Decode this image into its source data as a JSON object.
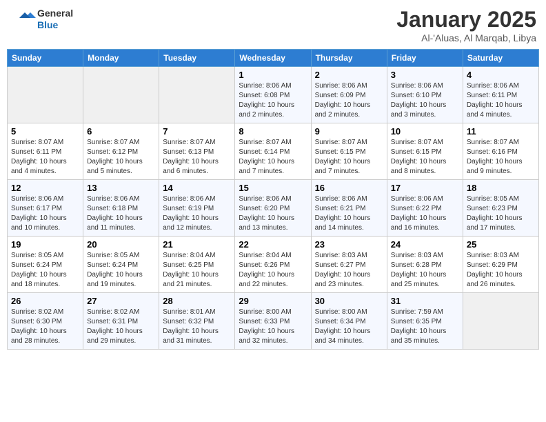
{
  "header": {
    "logo_general": "General",
    "logo_blue": "Blue",
    "month_title": "January 2025",
    "subtitle": "Al-'Aluas, Al Marqab, Libya"
  },
  "weekdays": [
    "Sunday",
    "Monday",
    "Tuesday",
    "Wednesday",
    "Thursday",
    "Friday",
    "Saturday"
  ],
  "weeks": [
    [
      {
        "day": "",
        "sunrise": "",
        "sunset": "",
        "daylight": "",
        "empty": true
      },
      {
        "day": "",
        "sunrise": "",
        "sunset": "",
        "daylight": "",
        "empty": true
      },
      {
        "day": "",
        "sunrise": "",
        "sunset": "",
        "daylight": "",
        "empty": true
      },
      {
        "day": "1",
        "sunrise": "Sunrise: 8:06 AM",
        "sunset": "Sunset: 6:08 PM",
        "daylight": "Daylight: 10 hours and 2 minutes."
      },
      {
        "day": "2",
        "sunrise": "Sunrise: 8:06 AM",
        "sunset": "Sunset: 6:09 PM",
        "daylight": "Daylight: 10 hours and 2 minutes."
      },
      {
        "day": "3",
        "sunrise": "Sunrise: 8:06 AM",
        "sunset": "Sunset: 6:10 PM",
        "daylight": "Daylight: 10 hours and 3 minutes."
      },
      {
        "day": "4",
        "sunrise": "Sunrise: 8:06 AM",
        "sunset": "Sunset: 6:11 PM",
        "daylight": "Daylight: 10 hours and 4 minutes."
      }
    ],
    [
      {
        "day": "5",
        "sunrise": "Sunrise: 8:07 AM",
        "sunset": "Sunset: 6:11 PM",
        "daylight": "Daylight: 10 hours and 4 minutes."
      },
      {
        "day": "6",
        "sunrise": "Sunrise: 8:07 AM",
        "sunset": "Sunset: 6:12 PM",
        "daylight": "Daylight: 10 hours and 5 minutes."
      },
      {
        "day": "7",
        "sunrise": "Sunrise: 8:07 AM",
        "sunset": "Sunset: 6:13 PM",
        "daylight": "Daylight: 10 hours and 6 minutes."
      },
      {
        "day": "8",
        "sunrise": "Sunrise: 8:07 AM",
        "sunset": "Sunset: 6:14 PM",
        "daylight": "Daylight: 10 hours and 7 minutes."
      },
      {
        "day": "9",
        "sunrise": "Sunrise: 8:07 AM",
        "sunset": "Sunset: 6:15 PM",
        "daylight": "Daylight: 10 hours and 7 minutes."
      },
      {
        "day": "10",
        "sunrise": "Sunrise: 8:07 AM",
        "sunset": "Sunset: 6:15 PM",
        "daylight": "Daylight: 10 hours and 8 minutes."
      },
      {
        "day": "11",
        "sunrise": "Sunrise: 8:07 AM",
        "sunset": "Sunset: 6:16 PM",
        "daylight": "Daylight: 10 hours and 9 minutes."
      }
    ],
    [
      {
        "day": "12",
        "sunrise": "Sunrise: 8:06 AM",
        "sunset": "Sunset: 6:17 PM",
        "daylight": "Daylight: 10 hours and 10 minutes."
      },
      {
        "day": "13",
        "sunrise": "Sunrise: 8:06 AM",
        "sunset": "Sunset: 6:18 PM",
        "daylight": "Daylight: 10 hours and 11 minutes."
      },
      {
        "day": "14",
        "sunrise": "Sunrise: 8:06 AM",
        "sunset": "Sunset: 6:19 PM",
        "daylight": "Daylight: 10 hours and 12 minutes."
      },
      {
        "day": "15",
        "sunrise": "Sunrise: 8:06 AM",
        "sunset": "Sunset: 6:20 PM",
        "daylight": "Daylight: 10 hours and 13 minutes."
      },
      {
        "day": "16",
        "sunrise": "Sunrise: 8:06 AM",
        "sunset": "Sunset: 6:21 PM",
        "daylight": "Daylight: 10 hours and 14 minutes."
      },
      {
        "day": "17",
        "sunrise": "Sunrise: 8:06 AM",
        "sunset": "Sunset: 6:22 PM",
        "daylight": "Daylight: 10 hours and 16 minutes."
      },
      {
        "day": "18",
        "sunrise": "Sunrise: 8:05 AM",
        "sunset": "Sunset: 6:23 PM",
        "daylight": "Daylight: 10 hours and 17 minutes."
      }
    ],
    [
      {
        "day": "19",
        "sunrise": "Sunrise: 8:05 AM",
        "sunset": "Sunset: 6:24 PM",
        "daylight": "Daylight: 10 hours and 18 minutes."
      },
      {
        "day": "20",
        "sunrise": "Sunrise: 8:05 AM",
        "sunset": "Sunset: 6:24 PM",
        "daylight": "Daylight: 10 hours and 19 minutes."
      },
      {
        "day": "21",
        "sunrise": "Sunrise: 8:04 AM",
        "sunset": "Sunset: 6:25 PM",
        "daylight": "Daylight: 10 hours and 21 minutes."
      },
      {
        "day": "22",
        "sunrise": "Sunrise: 8:04 AM",
        "sunset": "Sunset: 6:26 PM",
        "daylight": "Daylight: 10 hours and 22 minutes."
      },
      {
        "day": "23",
        "sunrise": "Sunrise: 8:03 AM",
        "sunset": "Sunset: 6:27 PM",
        "daylight": "Daylight: 10 hours and 23 minutes."
      },
      {
        "day": "24",
        "sunrise": "Sunrise: 8:03 AM",
        "sunset": "Sunset: 6:28 PM",
        "daylight": "Daylight: 10 hours and 25 minutes."
      },
      {
        "day": "25",
        "sunrise": "Sunrise: 8:03 AM",
        "sunset": "Sunset: 6:29 PM",
        "daylight": "Daylight: 10 hours and 26 minutes."
      }
    ],
    [
      {
        "day": "26",
        "sunrise": "Sunrise: 8:02 AM",
        "sunset": "Sunset: 6:30 PM",
        "daylight": "Daylight: 10 hours and 28 minutes."
      },
      {
        "day": "27",
        "sunrise": "Sunrise: 8:02 AM",
        "sunset": "Sunset: 6:31 PM",
        "daylight": "Daylight: 10 hours and 29 minutes."
      },
      {
        "day": "28",
        "sunrise": "Sunrise: 8:01 AM",
        "sunset": "Sunset: 6:32 PM",
        "daylight": "Daylight: 10 hours and 31 minutes."
      },
      {
        "day": "29",
        "sunrise": "Sunrise: 8:00 AM",
        "sunset": "Sunset: 6:33 PM",
        "daylight": "Daylight: 10 hours and 32 minutes."
      },
      {
        "day": "30",
        "sunrise": "Sunrise: 8:00 AM",
        "sunset": "Sunset: 6:34 PM",
        "daylight": "Daylight: 10 hours and 34 minutes."
      },
      {
        "day": "31",
        "sunrise": "Sunrise: 7:59 AM",
        "sunset": "Sunset: 6:35 PM",
        "daylight": "Daylight: 10 hours and 35 minutes."
      },
      {
        "day": "",
        "sunrise": "",
        "sunset": "",
        "daylight": "",
        "empty": true
      }
    ]
  ]
}
